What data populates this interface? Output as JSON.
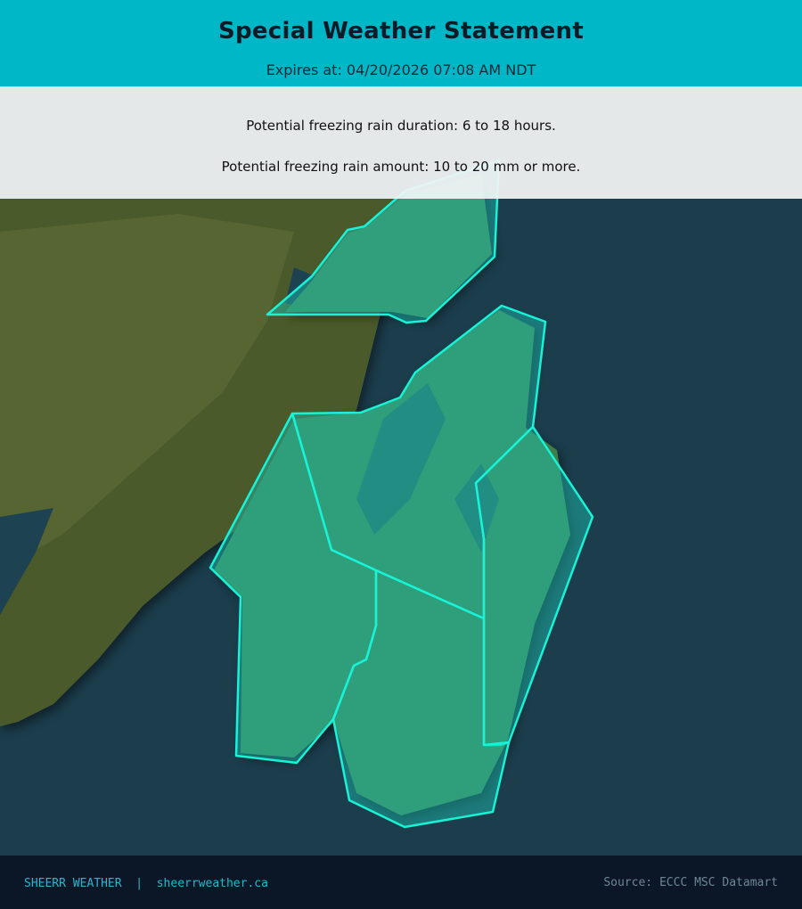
{
  "header": {
    "title": "Special Weather Statement",
    "expires": "Expires at: 04/20/2026 07:08 AM NDT"
  },
  "info": {
    "line1": "Potential freezing rain duration: 6 to 18 hours.",
    "line2": "Potential freezing rain amount: 10 to 20 mm or more."
  },
  "footer": {
    "brand": "SHEERR WEATHER",
    "separator": "|",
    "url": "sheerrweather.ca",
    "source": "Source: ECCC MSC Datamart"
  },
  "colors": {
    "header_bg": "#00b7c8",
    "alert_outline": "#18f2d6",
    "alert_fill": "#1fc6b6",
    "ocean": "#1b3d4c",
    "footer_bg": "#0b1626"
  }
}
